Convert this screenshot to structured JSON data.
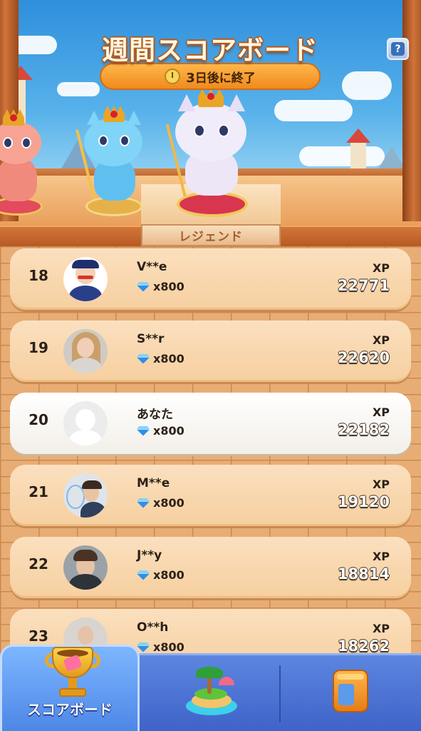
{
  "header": {
    "title": "週間スコアボード",
    "timer": {
      "days": "3",
      "suffix": "日後に終了"
    },
    "tier_label": "レジェンド",
    "help_glyph": "?"
  },
  "leaderboard": {
    "rows": [
      {
        "rank": "18",
        "name": "V**e",
        "reward": "x800",
        "xp_label": "XP",
        "xp": "22771",
        "is_me": false,
        "avatar": "cartoon-character"
      },
      {
        "rank": "19",
        "name": "S**r",
        "reward": "x800",
        "xp_label": "XP",
        "xp": "22620",
        "is_me": false,
        "avatar": "photo-woman"
      },
      {
        "rank": "20",
        "name": "あなた",
        "reward": "x800",
        "xp_label": "XP",
        "xp": "22182",
        "is_me": true,
        "avatar": "placeholder"
      },
      {
        "rank": "21",
        "name": "M**e",
        "reward": "x800",
        "xp_label": "XP",
        "xp": "19120",
        "is_me": false,
        "avatar": "photo-man"
      },
      {
        "rank": "22",
        "name": "J**y",
        "reward": "x800",
        "xp_label": "XP",
        "xp": "18814",
        "is_me": false,
        "avatar": "photo-man"
      },
      {
        "rank": "23",
        "name": "O**h",
        "reward": "x800",
        "xp_label": "XP",
        "xp": "18262",
        "is_me": false,
        "avatar": "photo-person"
      }
    ]
  },
  "bottom_nav": {
    "items": [
      {
        "label": "スコアボード",
        "icon": "trophy-icon",
        "active": true
      },
      {
        "label": "",
        "icon": "island-icon",
        "active": false
      },
      {
        "label": "",
        "icon": "locker-icon",
        "active": false
      }
    ]
  },
  "colors": {
    "row_bg": "#f6cf9f",
    "row_me_bg": "#ffffff",
    "nav_bg": "#3f63c9",
    "nav_active": "#4c86e6",
    "title_outline": "#b2591b"
  }
}
